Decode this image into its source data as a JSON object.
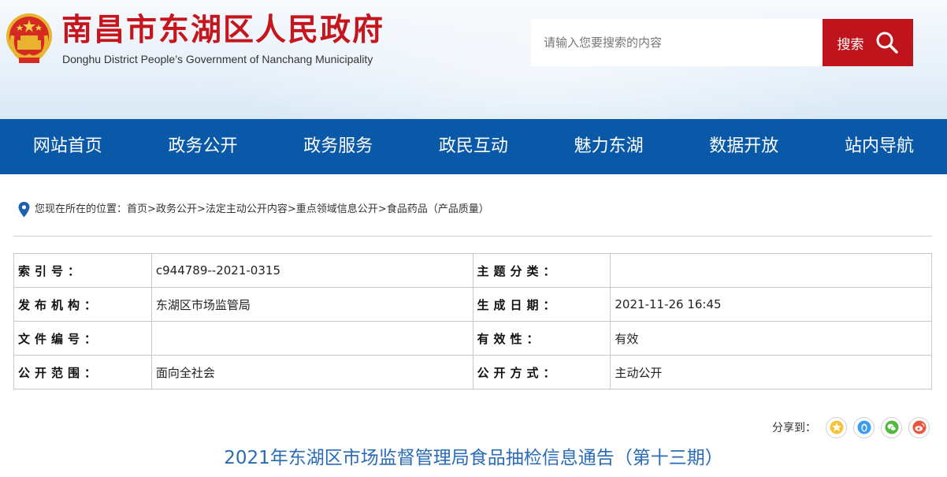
{
  "header": {
    "title": "南昌市东湖区人民政府",
    "subtitle": "Donghu District People’s Government of Nanchang Municipality",
    "search_placeholder": "请输入您要搜索的内容",
    "search_button": "搜索",
    "brand_color": "#c5161d"
  },
  "nav": {
    "items": [
      "网站首页",
      "政务公开",
      "政务服务",
      "政民互动",
      "魅力东湖",
      "数据开放",
      "站内导航"
    ],
    "background": "#0959a8"
  },
  "breadcrumb": {
    "prefix": "您现在所在的位置：",
    "items": [
      "首页",
      "政务公开",
      "法定主动公开内容",
      "重点领域信息公开",
      "食品药品（产品质量）"
    ],
    "separator": ">"
  },
  "info": {
    "rows": [
      {
        "l1": "索引号：",
        "v1": "c944789--2021-0315",
        "l2": "主题分类：",
        "v2": ""
      },
      {
        "l1": "发布机构：",
        "v1": "东湖区市场监管局",
        "l2": "生成日期：",
        "v2": "2021-11-26 16:45"
      },
      {
        "l1": "文件编号：",
        "v1": "",
        "l2": "有效性：",
        "v2": "有效"
      },
      {
        "l1": "公开范围：",
        "v1": "面向全社会",
        "l2": "公开方式：",
        "v2": "主动公开"
      }
    ]
  },
  "share": {
    "label": "分享到：",
    "icons": [
      "qzone-icon",
      "qq-icon",
      "wechat-icon",
      "weibo-icon"
    ]
  },
  "article": {
    "title": "2021年东湖区市场监督管理局食品抽检信息通告（第十三期）",
    "title_color": "#2a6bb8"
  }
}
